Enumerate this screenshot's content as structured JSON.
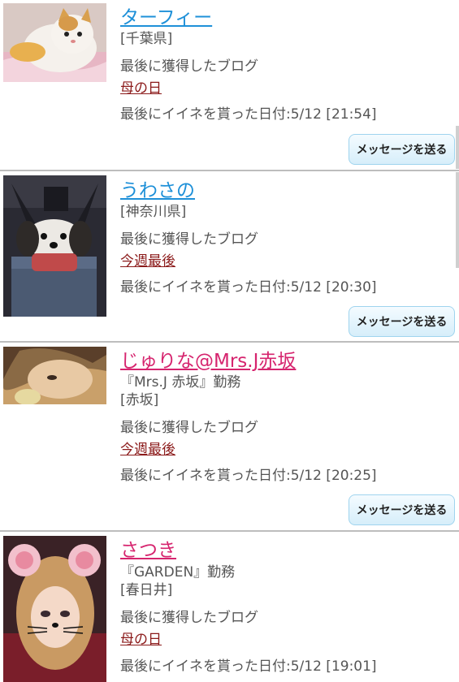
{
  "users": [
    {
      "name": "ターフィー",
      "workplace": "",
      "area": "[千葉県]",
      "blog_label": "最後に獲得したブログ",
      "blog_title": "母の日",
      "like_label": "最後にイイネを貰った日付:5/12 [21:54]",
      "button_label": "メッセージを送る",
      "avatar": "cat-photo"
    },
    {
      "name": "うわさの",
      "workplace": "",
      "area": "[神奈川県]",
      "blog_label": "最後に獲得したブログ",
      "blog_title": "今週最後",
      "like_label": "最後にイイネを貰った日付:5/12 [20:30]",
      "button_label": "メッセージを送る",
      "avatar": "dog-photo"
    },
    {
      "name": "じゅりな@Mrs.J赤坂",
      "workplace": "『Mrs.J 赤坂』勤務",
      "area": "[赤坂]",
      "blog_label": "最後に獲得したブログ",
      "blog_title": "今週最後",
      "like_label": "最後にイイネを貰った日付:5/12 [20:25]",
      "button_label": "メッセージを送る",
      "avatar": "woman-photo"
    },
    {
      "name": "さつき",
      "workplace": "『GARDEN』勤務",
      "area": "[春日井]",
      "blog_label": "最後に獲得したブログ",
      "blog_title": "母の日",
      "like_label": "最後にイイネを貰った日付:5/12 [19:01]",
      "button_label": "",
      "avatar": "woman-mouse-filter-photo"
    }
  ],
  "colors": {
    "name_blue": "#1e90d8",
    "name_pink": "#d6246e",
    "blog_link": "#8b1a1a",
    "button_border": "#9fd4ee"
  }
}
